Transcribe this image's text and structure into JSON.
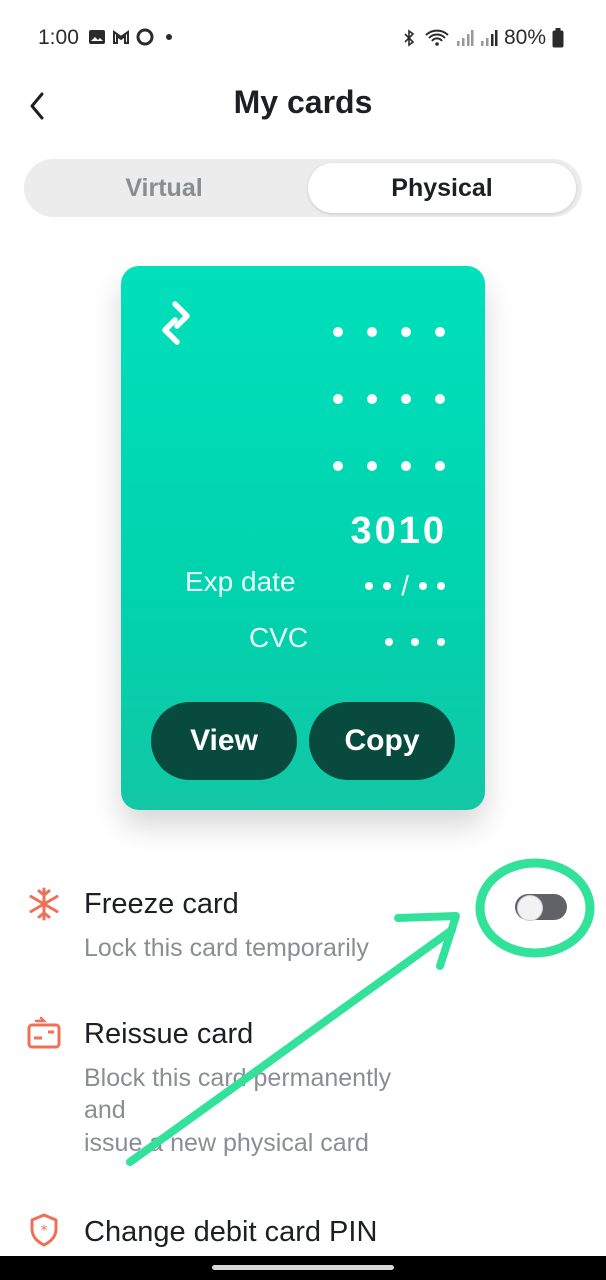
{
  "status_bar": {
    "time": "1:00",
    "battery": "80%"
  },
  "header": {
    "title": "My cards"
  },
  "tabs": [
    {
      "label": "Virtual"
    },
    {
      "label": "Physical"
    }
  ],
  "card": {
    "last4": "3010",
    "exp_label": "Exp date",
    "exp_sep": "/",
    "cvc_label": "CVC",
    "view_label": "View",
    "copy_label": "Copy",
    "color": "#00dcb6"
  },
  "options": [
    {
      "label": "Freeze card",
      "sub": "Lock this card temporarily",
      "toggle_on": false
    },
    {
      "label": "Reissue card",
      "sub_line1": "Block this card permanently",
      "sub_line2": "and",
      "sub_line3": "issue a new physical card"
    },
    {
      "label": "Change debit card PIN"
    }
  ],
  "colors": {
    "accent": "#00dcb6",
    "icon_red": "#ef6f57",
    "annotation": "#33e29a"
  }
}
